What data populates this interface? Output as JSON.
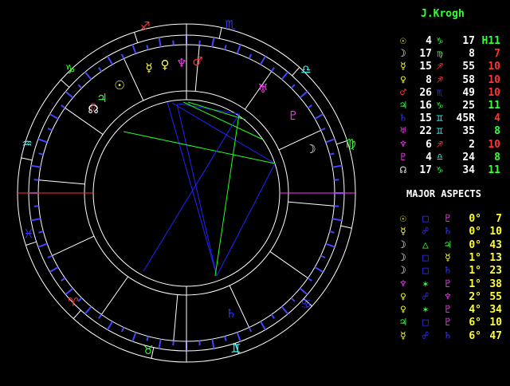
{
  "person_name": "J.Krogh",
  "aspects_heading": "MAJOR ASPECTS",
  "colors": {
    "background": "#000000",
    "wheel": "#ffffff",
    "fire": "#ff3333",
    "earth": "#33ff33",
    "air": "#33ffff",
    "water": "#3333ff",
    "yellow": "#ffff33",
    "magenta": "#ff33ff",
    "cusp": "#ff3333",
    "aspect_blue": "#2222ff",
    "aspect_green": "#22ff22"
  },
  "positions": [
    {
      "glyph": "☉",
      "glyph_color": "#ffff33",
      "deg": "4",
      "sign": "♑",
      "sign_color": "#33ff33",
      "min": "17",
      "extra": "H11",
      "extra_color": "#33ff33"
    },
    {
      "glyph": "☽",
      "glyph_color": "#ffffff",
      "deg": "17",
      "sign": "♍",
      "sign_color": "#33ff33",
      "min": "8",
      "extra": "7",
      "extra_color": "#ff3333"
    },
    {
      "glyph": "☿",
      "glyph_color": "#ffff33",
      "deg": "15",
      "sign": "♐",
      "sign_color": "#ff3333",
      "min": "55",
      "extra": "10",
      "extra_color": "#ff3333"
    },
    {
      "glyph": "♀",
      "glyph_color": "#ffff33",
      "deg": "8",
      "sign": "♐",
      "sign_color": "#ff3333",
      "min": "58",
      "extra": "10",
      "extra_color": "#ff3333"
    },
    {
      "glyph": "♂",
      "glyph_color": "#ff3333",
      "deg": "26",
      "sign": "♏",
      "sign_color": "#3333ff",
      "min": "49",
      "extra": "10",
      "extra_color": "#ff3333"
    },
    {
      "glyph": "♃",
      "glyph_color": "#33ff33",
      "deg": "16",
      "sign": "♑",
      "sign_color": "#33ff33",
      "min": "25",
      "extra": "11",
      "extra_color": "#33ff33"
    },
    {
      "glyph": "♄",
      "glyph_color": "#3333ff",
      "deg": "15",
      "sign": "♊",
      "sign_color": "#33ffff",
      "min": "45R",
      "extra": "4",
      "extra_color": "#ff3333"
    },
    {
      "glyph": "♅",
      "glyph_color": "#ff33ff",
      "deg": "22",
      "sign": "♊",
      "sign_color": "#33ffff",
      "min": "35",
      "extra": "8",
      "extra_color": "#33ff33"
    },
    {
      "glyph": "♆",
      "glyph_color": "#ff33ff",
      "deg": "6",
      "sign": "♐",
      "sign_color": "#ff3333",
      "min": "2",
      "extra": "10",
      "extra_color": "#ff3333"
    },
    {
      "glyph": "♇",
      "glyph_color": "#ff33ff",
      "deg": "4",
      "sign": "♎",
      "sign_color": "#33ffff",
      "min": "24",
      "extra": "8",
      "extra_color": "#33ff33"
    },
    {
      "glyph": "☊",
      "glyph_color": "#ffffff",
      "deg": "17",
      "sign": "♑",
      "sign_color": "#33ff33",
      "min": "34",
      "extra": "11",
      "extra_color": "#33ff33"
    }
  ],
  "aspects": [
    {
      "p1": "☉",
      "p1_color": "#ffff33",
      "asp": "□",
      "asp_color": "#3333ff",
      "p2": "♇",
      "p2_color": "#ff33ff",
      "orb_deg": "0°",
      "orb_min": "7"
    },
    {
      "p1": "☿",
      "p1_color": "#ffff33",
      "asp": "☍",
      "asp_color": "#3333ff",
      "p2": "♄",
      "p2_color": "#3333ff",
      "orb_deg": "0°",
      "orb_min": "10"
    },
    {
      "p1": "☽",
      "p1_color": "#ffffff",
      "asp": "△",
      "asp_color": "#33ff33",
      "p2": "♃",
      "p2_color": "#33ff33",
      "orb_deg": "0°",
      "orb_min": "43"
    },
    {
      "p1": "☽",
      "p1_color": "#ffffff",
      "asp": "□",
      "asp_color": "#3333ff",
      "p2": "☿",
      "p2_color": "#ffff33",
      "orb_deg": "1°",
      "orb_min": "13"
    },
    {
      "p1": "☽",
      "p1_color": "#ffffff",
      "asp": "□",
      "asp_color": "#3333ff",
      "p2": "♄",
      "p2_color": "#3333ff",
      "orb_deg": "1°",
      "orb_min": "23"
    },
    {
      "p1": "♆",
      "p1_color": "#ff33ff",
      "asp": "✶",
      "asp_color": "#33ff33",
      "p2": "♇",
      "p2_color": "#ff33ff",
      "orb_deg": "1°",
      "orb_min": "38"
    },
    {
      "p1": "♀",
      "p1_color": "#ffff33",
      "asp": "☍",
      "asp_color": "#3333ff",
      "p2": "♆",
      "p2_color": "#ff33ff",
      "orb_deg": "2°",
      "orb_min": "55"
    },
    {
      "p1": "♀",
      "p1_color": "#ffff33",
      "asp": "✶",
      "asp_color": "#33ff33",
      "p2": "♇",
      "p2_color": "#ff33ff",
      "orb_deg": "4°",
      "orb_min": "34"
    },
    {
      "p1": "♃",
      "p1_color": "#33ff33",
      "asp": "□",
      "asp_color": "#3333ff",
      "p2": "♇",
      "p2_color": "#ff33ff",
      "orb_deg": "6°",
      "orb_min": "10"
    },
    {
      "p1": "☿",
      "p1_color": "#ffff33",
      "asp": "☍",
      "asp_color": "#3333ff",
      "p2": "♄",
      "p2_color": "#3333ff",
      "orb_deg": "6°",
      "orb_min": "47"
    }
  ],
  "wheel_signs": [
    {
      "glyph": "♐",
      "color": "#ff3333"
    },
    {
      "glyph": "♏",
      "color": "#3333ff"
    },
    {
      "glyph": "♑",
      "color": "#33ff33"
    },
    {
      "glyph": "♎",
      "color": "#33ffff"
    },
    {
      "glyph": "♒",
      "color": "#33ffff"
    },
    {
      "glyph": "♍",
      "color": "#33ff33"
    },
    {
      "glyph": "♓",
      "color": "#3333ff"
    },
    {
      "glyph": "♌",
      "color": "#ff3333"
    },
    {
      "glyph": "♈",
      "color": "#ff3333"
    },
    {
      "glyph": "♋",
      "color": "#3333ff"
    },
    {
      "glyph": "♉",
      "color": "#33ff33"
    },
    {
      "glyph": "♊",
      "color": "#33ffff"
    }
  ],
  "wheel_planets": [
    {
      "glyph": "☊",
      "color": "#ffffff"
    },
    {
      "glyph": "♃",
      "color": "#33ff33"
    },
    {
      "glyph": "☉",
      "color": "#ffff33"
    },
    {
      "glyph": "☿",
      "color": "#ffff33"
    },
    {
      "glyph": "♀",
      "color": "#ffff33"
    },
    {
      "glyph": "♆",
      "color": "#ff33ff"
    },
    {
      "glyph": "♂",
      "color": "#ff3333"
    },
    {
      "glyph": "♅",
      "color": "#ff33ff"
    },
    {
      "glyph": "♇",
      "color": "#ff33ff"
    },
    {
      "glyph": "☽",
      "color": "#ffffff"
    },
    {
      "glyph": "♄",
      "color": "#3333ff"
    }
  ]
}
